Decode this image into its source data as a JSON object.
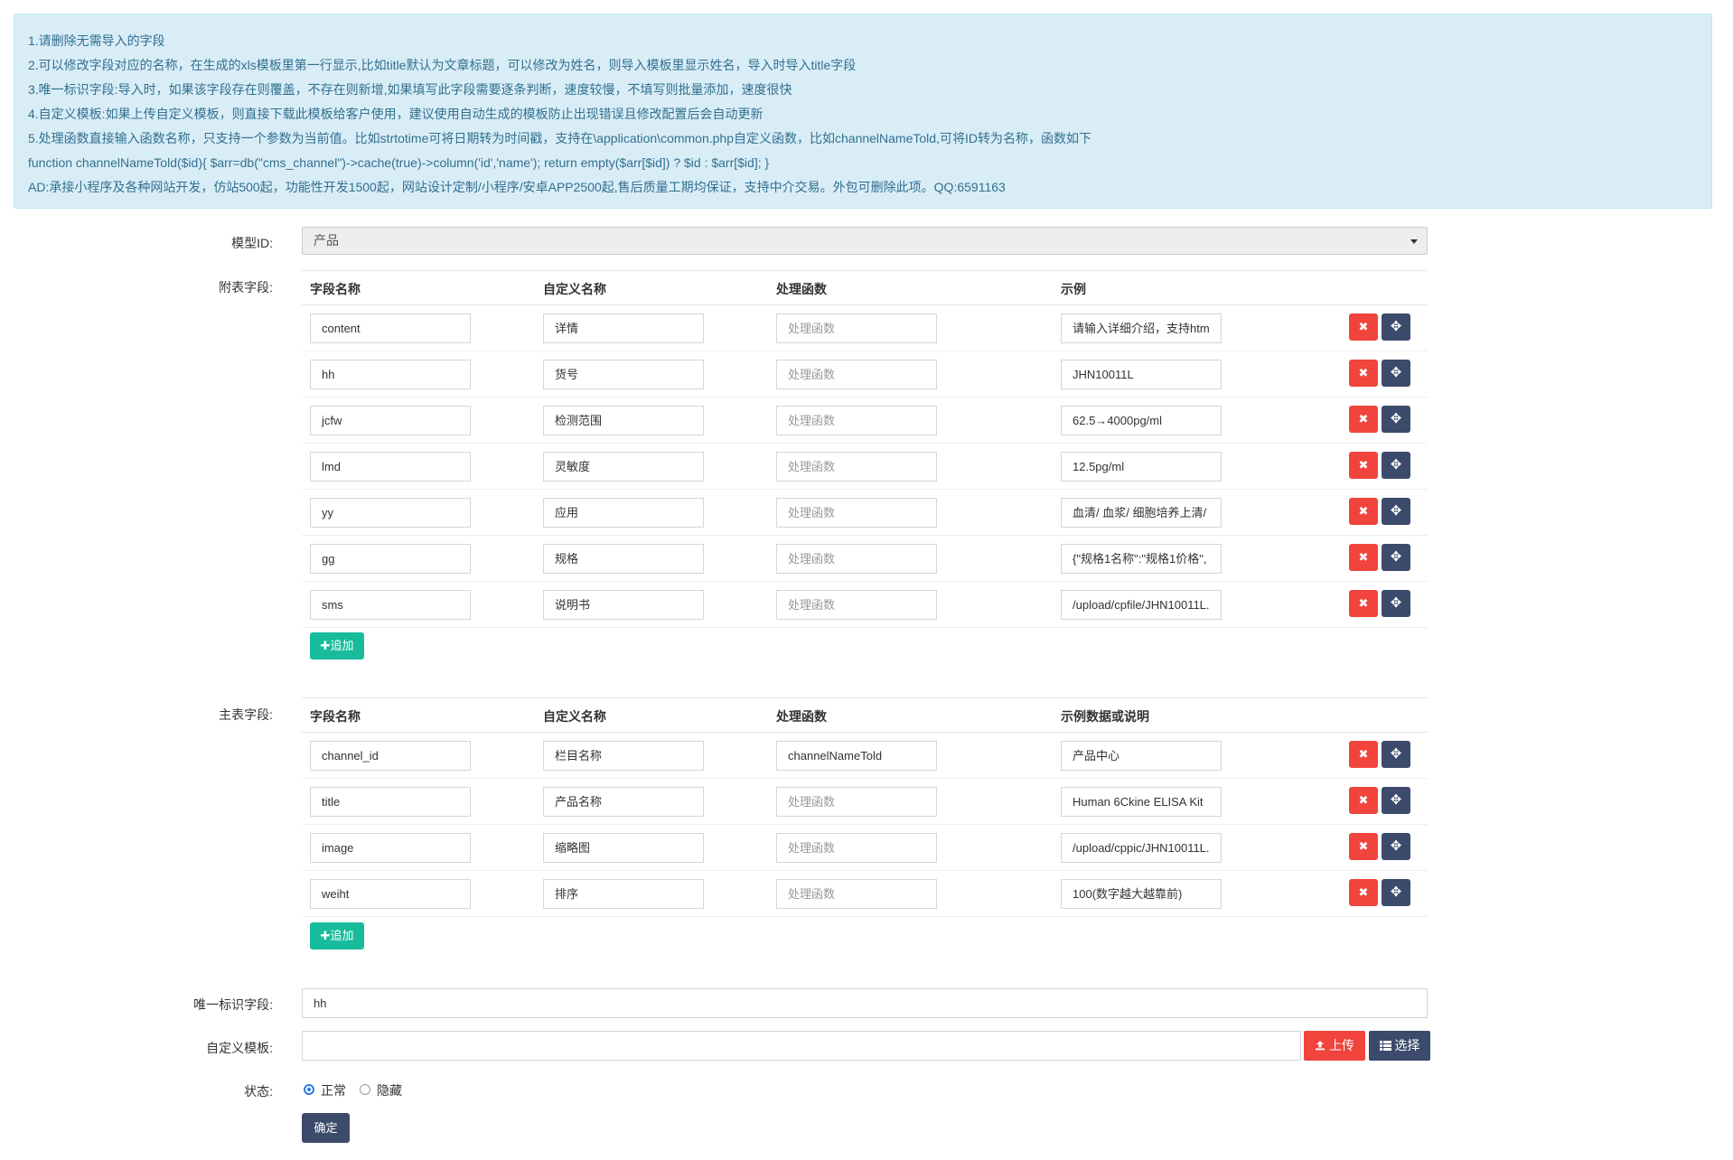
{
  "notice": {
    "lines": [
      "1.请删除无需导入的字段",
      "2.可以修改字段对应的名称，在生成的xls模板里第一行显示,比如title默认为文章标题，可以修改为姓名，则导入模板里显示姓名，导入时导入title字段",
      "3.唯一标识字段:导入时，如果该字段存在则覆盖，不存在则新增,如果填写此字段需要逐条判断，速度较慢，不填写则批量添加，速度很快",
      "4.自定义模板:如果上传自定义模板，则直接下载此模板给客户使用，建议使用自动生成的模板防止出现错误且修改配置后会自动更新",
      "5.处理函数直接输入函数名称，只支持一个参数为当前值。比如strtotime可将日期转为时间戳，支持在\\application\\common.php自定义函数，比如channelNameTold,可将ID转为名称，函数如下",
      "function channelNameTold($id){ $arr=db(\"cms_channel\")->cache(true)->column('id','name'); return empty($arr[$id]) ? $id : $arr[$id]; }",
      "AD:承接小程序及各种网站开发，仿站500起，功能性开发1500起，网站设计定制/小程序/安卓APP2500起,售后质量工期均保证，支持中介交易。外包可删除此项。QQ:6591163"
    ]
  },
  "model": {
    "label": "模型ID:",
    "value": "产品"
  },
  "sub_fields": {
    "label": "附表字段:",
    "headers": [
      "字段名称",
      "自定义名称",
      "处理函数",
      "示例"
    ],
    "func_placeholder": "处理函数",
    "rows": [
      {
        "field": "content",
        "name": "详情",
        "func": "",
        "example": "请输入详细介绍，支持htm"
      },
      {
        "field": "hh",
        "name": "货号",
        "func": "",
        "example": "JHN10011L"
      },
      {
        "field": "jcfw",
        "name": "检测范围",
        "func": "",
        "example": "62.5→4000pg/ml"
      },
      {
        "field": "lmd",
        "name": "灵敏度",
        "func": "",
        "example": "12.5pg/ml"
      },
      {
        "field": "yy",
        "name": "应用",
        "func": "",
        "example": "血清/ 血浆/ 细胞培养上清/"
      },
      {
        "field": "gg",
        "name": "规格",
        "func": "",
        "example": "{\"规格1名称\":\"规格1价格\","
      },
      {
        "field": "sms",
        "name": "说明书",
        "func": "",
        "example": "/upload/cpfile/JHN10011L."
      }
    ],
    "add_label": "✚追加"
  },
  "main_fields": {
    "label": "主表字段:",
    "headers": [
      "字段名称",
      "自定义名称",
      "处理函数",
      "示例数据或说明"
    ],
    "func_placeholder": "处理函数",
    "rows": [
      {
        "field": "channel_id",
        "name": "栏目名称",
        "func": "channelNameTold",
        "example": "产品中心"
      },
      {
        "field": "title",
        "name": "产品名称",
        "func": "",
        "example": "Human 6Ckine ELISA Kit"
      },
      {
        "field": "image",
        "name": "缩略图",
        "func": "",
        "example": "/upload/cppic/JHN10011L."
      },
      {
        "field": "weiht",
        "name": "排序",
        "func": "",
        "example": "100(数字越大越靠前)"
      }
    ],
    "add_label": "✚追加"
  },
  "unique_field": {
    "label": "唯一标识字段:",
    "value": "hh"
  },
  "custom_template": {
    "label": "自定义模板:",
    "value": "",
    "upload_label": "上传",
    "choose_label": "选择"
  },
  "status": {
    "label": "状态:",
    "options": [
      "正常",
      "隐藏"
    ],
    "selected": "正常"
  },
  "submit_label": "确定",
  "colors": {
    "danger": "#f0443d",
    "dark": "#3c4a6b",
    "success": "#18bc9c",
    "info_bg": "#d9edf7",
    "info_text": "#31708f",
    "radio_active": "#2c7be5"
  },
  "icons": {
    "delete": "close-icon",
    "move": "move-arrows-icon",
    "upload": "upload-icon",
    "choose": "list-icon",
    "add": "plus-icon"
  }
}
